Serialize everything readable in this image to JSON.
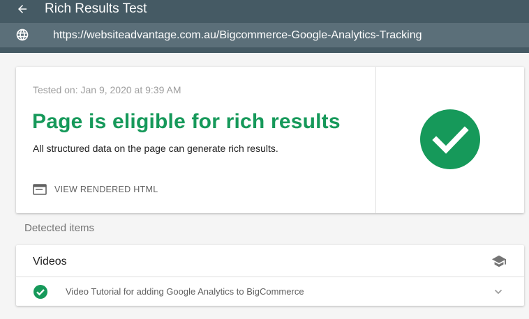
{
  "appbar": {
    "title": "Rich Results Test",
    "url": "https://websiteadvantage.com.au/Bigcommerce-Google-Analytics-Tracking"
  },
  "summary": {
    "tested_on": "Tested on: Jan 9, 2020 at 9:39 AM",
    "headline": "Page is eligible for rich results",
    "subline": "All structured data on the page can generate rich results.",
    "view_rendered_label": "VIEW RENDERED HTML"
  },
  "detected": {
    "heading": "Detected items",
    "groups": [
      {
        "title": "Videos",
        "items": [
          {
            "label": "Video Tutorial for adding Google Analytics to BigCommerce"
          }
        ]
      }
    ]
  },
  "icons": {
    "back": "arrow-back-icon",
    "url": "globe-icon",
    "view_rendered": "browser-window-icon",
    "status": "check-circle-icon",
    "group": "school-icon",
    "expand": "chevron-down-icon"
  },
  "colors": {
    "appbar": "#455a64",
    "urlbar": "#5b6f79",
    "success": "#16995a",
    "background": "#f5f5f5"
  }
}
